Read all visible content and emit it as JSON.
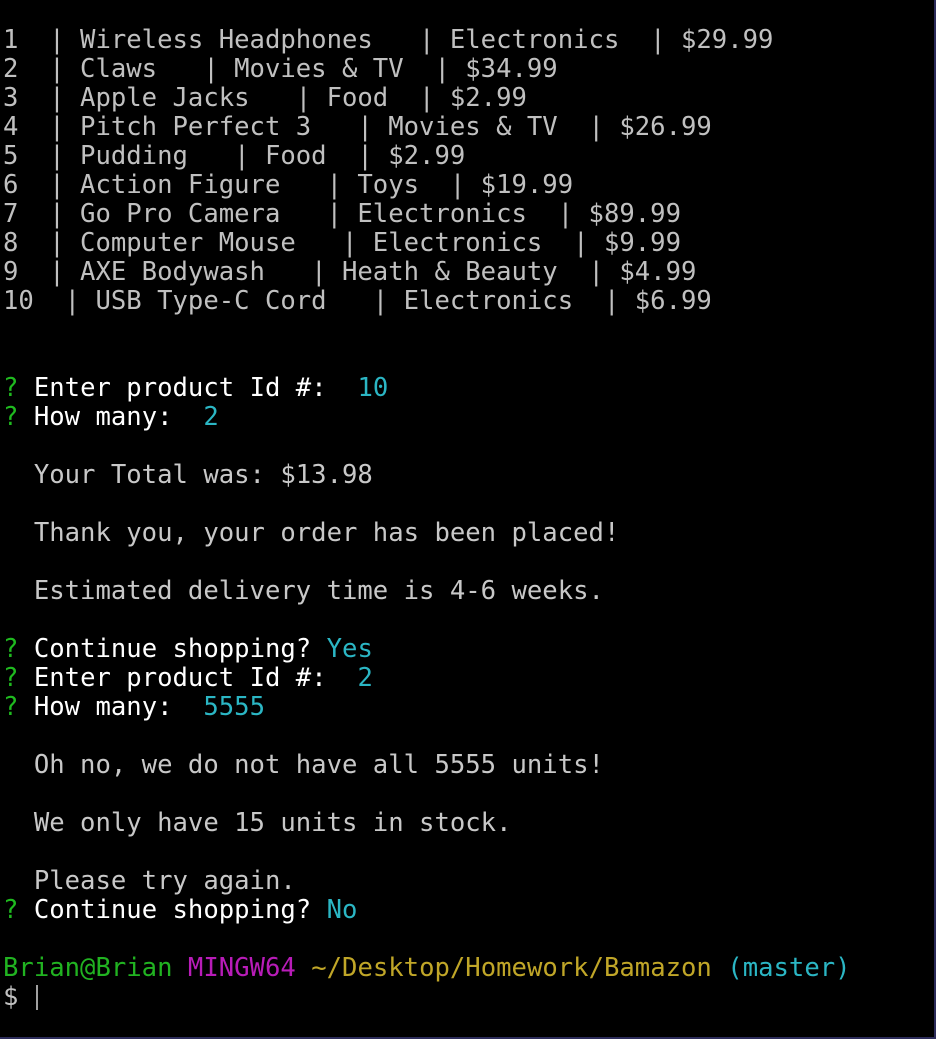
{
  "product_rows": [
    {
      "line": "1  | Wireless Headphones   | Electronics  | $29.99"
    },
    {
      "line": "2  | Claws   | Movies & TV  | $34.99"
    },
    {
      "line": "3  | Apple Jacks   | Food  | $2.99"
    },
    {
      "line": "4  | Pitch Perfect 3   | Movies & TV  | $26.99"
    },
    {
      "line": "5  | Pudding   | Food  | $2.99"
    },
    {
      "line": "6  | Action Figure   | Toys  | $19.99"
    },
    {
      "line": "7  | Go Pro Camera   | Electronics  | $89.99"
    },
    {
      "line": "8  | Computer Mouse   | Electronics  | $9.99"
    },
    {
      "line": "9  | AXE Bodywash   | Heath & Beauty  | $4.99"
    },
    {
      "line": "10  | USB Type-C Cord   | Electronics  | $6.99"
    }
  ],
  "session": {
    "q_mark": "?",
    "order1": {
      "id_label": "Enter product Id #:  ",
      "id_value": "10",
      "qty_label": "How many:  ",
      "qty_value": "2",
      "total": "  Your Total was: $13.98",
      "thanks": "  Thank you, your order has been placed!",
      "delivery": "  Estimated delivery time is 4-6 weeks."
    },
    "continue1": {
      "label": "Continue shopping? ",
      "value": "Yes"
    },
    "order2": {
      "id_label": "Enter product Id #:  ",
      "id_value": "2",
      "qty_label": "How many:  ",
      "qty_value": "5555",
      "oh_no": "  Oh no, we do not have all 5555 units!",
      "stock": "  We only have 15 units in stock.",
      "retry": "  Please try again."
    },
    "continue2": {
      "label": "Continue shopping? ",
      "value": "No"
    }
  },
  "shell": {
    "user_host": "Brian@Brian",
    "msystem": "MINGW64",
    "path": "~/Desktop/Homework/Bamazon",
    "branch": "(master)",
    "dollar": "$ "
  },
  "colors": {
    "background": "#000000",
    "text": "#c0c0c0",
    "prompt_q": "#1fba1f",
    "answer": "#2bb6c4",
    "user_host": "#21b321",
    "msystem": "#b81cb8",
    "path": "#c0a628"
  }
}
